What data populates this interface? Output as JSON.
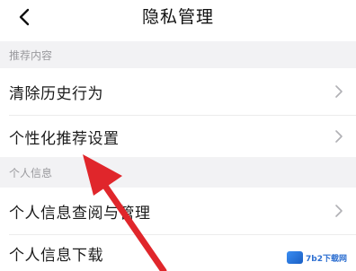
{
  "header": {
    "title": "隐私管理",
    "back_icon": "chevron-left-icon"
  },
  "sections": [
    {
      "title": "推荐内容",
      "items": [
        {
          "label": "清除历史行为",
          "icon": "chevron-right-icon"
        },
        {
          "label": "个性化推荐设置",
          "icon": "chevron-right-icon"
        }
      ]
    },
    {
      "title": "个人信息",
      "items": [
        {
          "label": "个人信息查阅与管理",
          "icon": "chevron-right-icon"
        },
        {
          "label": "个人信息下载",
          "icon": "chevron-right-icon"
        }
      ]
    }
  ],
  "annotation": {
    "arrow_color": "#e0262b"
  },
  "watermark": {
    "text": "7b2下载网"
  },
  "colors": {
    "section_bg": "#f2f2f4",
    "section_text": "#9a9a9e",
    "row_bg": "#ffffff"
  }
}
